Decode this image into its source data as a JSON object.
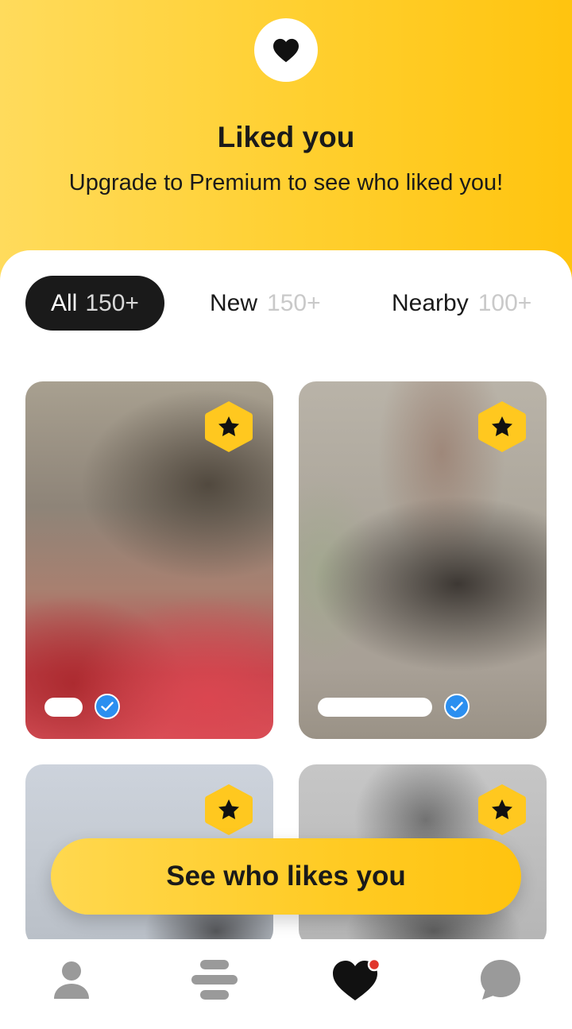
{
  "header": {
    "icon": "heart-icon",
    "title": "Liked you",
    "subtitle": "Upgrade to Premium to see who liked you!",
    "accent_color": "#ffc40f"
  },
  "tabs": [
    {
      "label": "All",
      "count": "150+",
      "active": true
    },
    {
      "label": "New",
      "count": "150+",
      "active": false
    },
    {
      "label": "Nearby",
      "count": "100+",
      "active": false
    }
  ],
  "cards": [
    {
      "badge": "star-icon",
      "verified": true
    },
    {
      "badge": "star-icon",
      "verified": true
    },
    {
      "badge": "star-icon",
      "verified": false
    },
    {
      "badge": "star-icon",
      "verified": false
    }
  ],
  "cta": {
    "label": "See who likes you"
  },
  "bottom_nav": [
    {
      "icon": "profile-icon",
      "active": false
    },
    {
      "icon": "discover-stack-icon",
      "active": false
    },
    {
      "icon": "liked-you-heart-icon",
      "active": true,
      "notification_dot": true
    },
    {
      "icon": "chat-bubble-icon",
      "active": false
    }
  ]
}
